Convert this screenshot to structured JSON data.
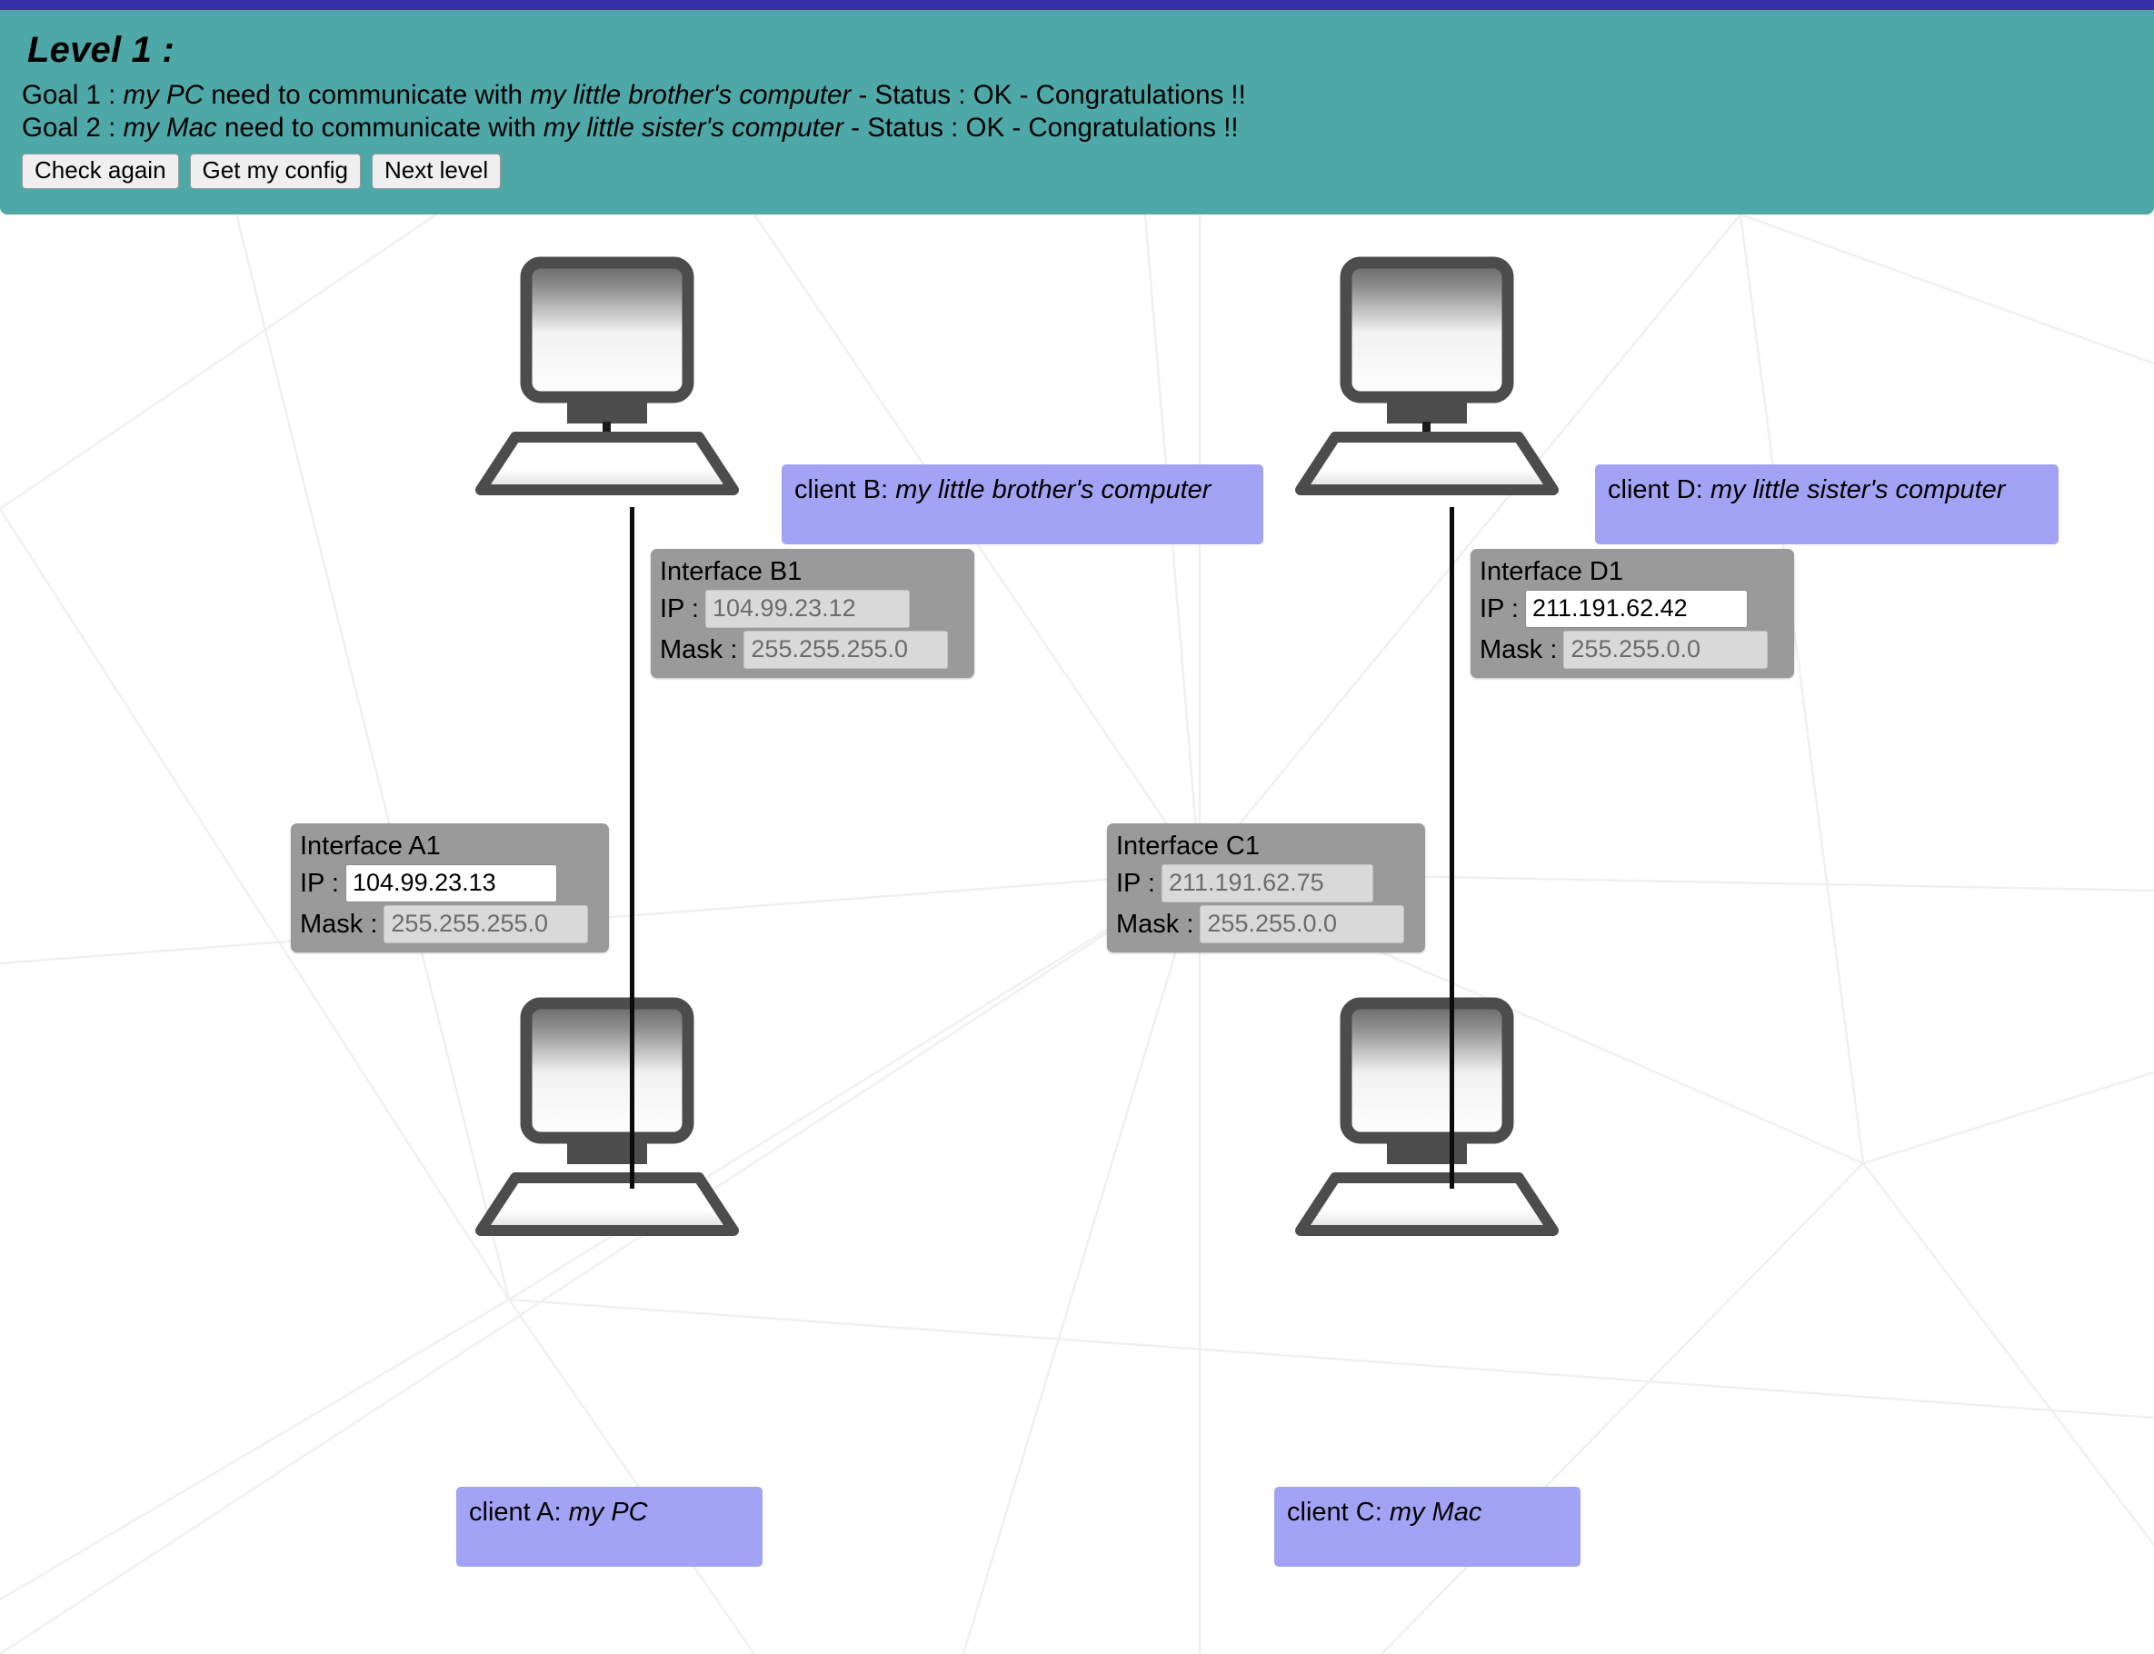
{
  "theme": {
    "top_strip_color": "#3730a8",
    "header_bg": "#4fa8a8",
    "client_label_bg": "#a3a3f5",
    "interface_box_bg": "#9a9a9a",
    "cable_color": "#0b0b0b",
    "page_bg": "#ffffff"
  },
  "header": {
    "level_title": "Level 1 :",
    "goals": [
      {
        "prefix": "Goal 1 : ",
        "source": "my PC",
        "middle": " need to communicate with ",
        "target": "my little brother's computer",
        "suffix": " - Status : OK - Congratulations !!"
      },
      {
        "prefix": "Goal 2 : ",
        "source": "my Mac",
        "middle": " need to communicate with ",
        "target": "my little sister's computer",
        "suffix": " - Status : OK - Congratulations !!"
      }
    ],
    "buttons": [
      {
        "label": "Check again",
        "name": "check-again-button"
      },
      {
        "label": "Get my config",
        "name": "get-my-config-button"
      },
      {
        "label": "Next level",
        "name": "next-level-button"
      }
    ]
  },
  "clients": {
    "a": {
      "prefix": "client A:",
      "name": "my PC"
    },
    "b": {
      "prefix": "client B:",
      "name": "my little brother's computer"
    },
    "c": {
      "prefix": "client C:",
      "name": "my Mac"
    },
    "d": {
      "prefix": "client D:",
      "name": "my little sister's computer"
    }
  },
  "interfaces": {
    "a1": {
      "title": "Interface A1",
      "ip_label": "IP :",
      "ip_value": "104.99.23.13",
      "ip_editable": true,
      "mask_label": "Mask :",
      "mask_value": "255.255.255.0",
      "mask_editable": false
    },
    "b1": {
      "title": "Interface B1",
      "ip_label": "IP :",
      "ip_value": "104.99.23.12",
      "ip_editable": false,
      "mask_label": "Mask :",
      "mask_value": "255.255.255.0",
      "mask_editable": false
    },
    "c1": {
      "title": "Interface C1",
      "ip_label": "IP :",
      "ip_value": "211.191.62.75",
      "ip_editable": false,
      "mask_label": "Mask :",
      "mask_value": "255.255.0.0",
      "mask_editable": false
    },
    "d1": {
      "title": "Interface D1",
      "ip_label": "IP :",
      "ip_value": "211.191.62.42",
      "ip_editable": true,
      "mask_label": "Mask :",
      "mask_value": "255.255.0.0",
      "mask_editable": false
    }
  },
  "icons": {
    "computer": "desktop-computer-icon",
    "cable": "network-cable-link"
  }
}
